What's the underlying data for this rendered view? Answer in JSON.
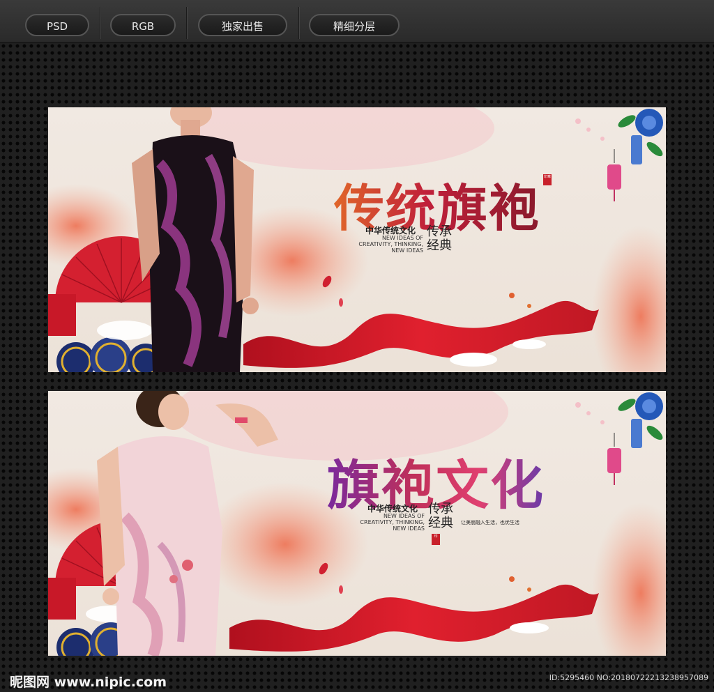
{
  "tags": [
    "PSD",
    "RGB",
    "独家出售",
    "精细分层"
  ],
  "banner1": {
    "title": "传统旗袍",
    "slogan_cn": "中华传统文化",
    "slogan_en": "NEW IDEAS OF CREATIVITY, THINKING, NEW IDEAS",
    "chuancheng": "传承",
    "jingdian": "经典"
  },
  "banner2": {
    "title": "旗袍文化",
    "slogan_cn": "中华传统文化",
    "slogan_en": "NEW IDEAS OF CREATIVITY, THINKING, NEW IDEAS",
    "chuancheng": "传承",
    "jingdian": "经典",
    "side_text": "让美丽融入生活，也优生活"
  },
  "watermark": {
    "logo": "昵图网 www.nipic.com",
    "id_text": "ID:5295460 NO:20180722213238957089"
  },
  "colors": {
    "ribbon": "#d4202a",
    "accent_purple": "#7a2a9c",
    "paper": "#efe6dc"
  }
}
